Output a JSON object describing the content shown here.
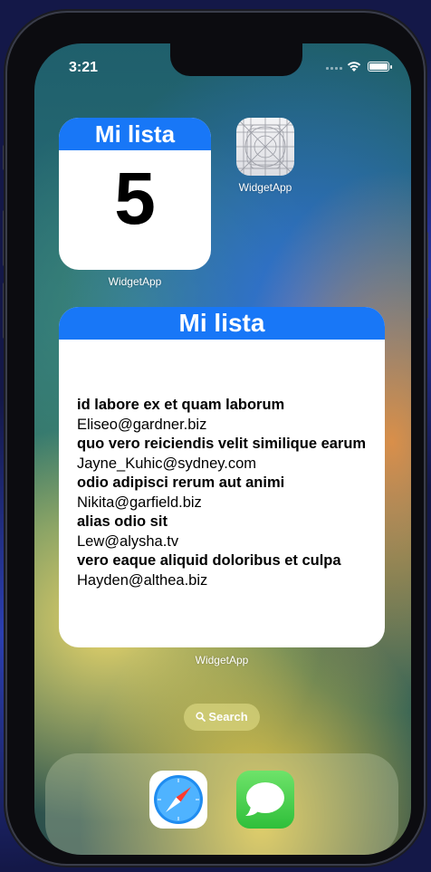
{
  "status_bar": {
    "time": "3:21"
  },
  "small_widget": {
    "title": "Mi lista",
    "count": "5",
    "app_label": "WidgetApp"
  },
  "app_icon": {
    "label": "WidgetApp",
    "icon": "widgetapp-blueprint-icon"
  },
  "large_widget": {
    "title": "Mi lista",
    "app_label": "WidgetApp",
    "items": [
      {
        "title": "id labore ex et quam laborum",
        "email": "Eliseo@gardner.biz"
      },
      {
        "title": "quo vero reiciendis velit similique earum",
        "email": "Jayne_Kuhic@sydney.com"
      },
      {
        "title": "odio adipisci rerum aut animi",
        "email": "Nikita@garfield.biz"
      },
      {
        "title": "alias odio sit",
        "email": "Lew@alysha.tv"
      },
      {
        "title": "vero eaque aliquid doloribus et culpa",
        "email": "Hayden@althea.biz"
      }
    ]
  },
  "search": {
    "label": "Search"
  },
  "dock": {
    "apps": [
      "safari-icon",
      "messages-icon"
    ]
  },
  "colors": {
    "widget_header": "#1877f7"
  }
}
